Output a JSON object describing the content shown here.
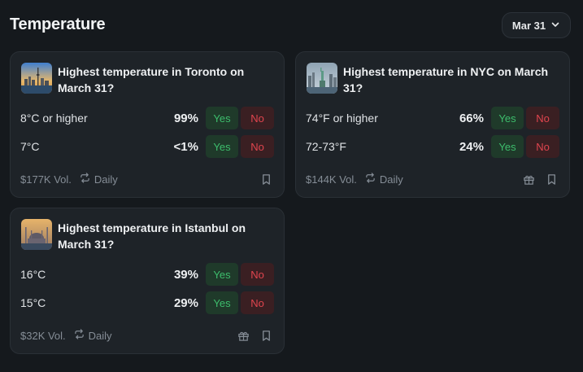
{
  "page": {
    "title": "Temperature"
  },
  "date_filter": {
    "label": "Mar 31",
    "icon": "chevron-down-icon"
  },
  "colors": {
    "yes": "#3dbd6c",
    "no": "#e0454e",
    "card_bg": "#1e2328",
    "page_bg": "#15191d"
  },
  "cards": [
    {
      "title": "Highest temperature in Toronto on March 31?",
      "thumbnail": "toronto-skyline-image",
      "outcomes": [
        {
          "label": "8°C or higher",
          "pct": "99%",
          "yes": "Yes",
          "no": "No"
        },
        {
          "label": "7°C",
          "pct": "<1%",
          "yes": "Yes",
          "no": "No"
        }
      ],
      "volume": "$177K Vol.",
      "recurrence": "Daily",
      "icons": [
        "repeat-icon",
        "bookmark-icon"
      ]
    },
    {
      "title": "Highest temperature in NYC on March 31?",
      "thumbnail": "nyc-statue-of-liberty-image",
      "outcomes": [
        {
          "label": "74°F or higher",
          "pct": "66%",
          "yes": "Yes",
          "no": "No"
        },
        {
          "label": "72-73°F",
          "pct": "24%",
          "yes": "Yes",
          "no": "No"
        }
      ],
      "volume": "$144K Vol.",
      "recurrence": "Daily",
      "icons": [
        "repeat-icon",
        "gift-icon",
        "bookmark-icon"
      ]
    },
    {
      "title": "Highest temperature in Istanbul on March 31?",
      "thumbnail": "istanbul-mosque-image",
      "outcomes": [
        {
          "label": "16°C",
          "pct": "39%",
          "yes": "Yes",
          "no": "No"
        },
        {
          "label": "15°C",
          "pct": "29%",
          "yes": "Yes",
          "no": "No"
        }
      ],
      "volume": "$32K Vol.",
      "recurrence": "Daily",
      "icons": [
        "repeat-icon",
        "gift-icon",
        "bookmark-icon"
      ]
    }
  ]
}
